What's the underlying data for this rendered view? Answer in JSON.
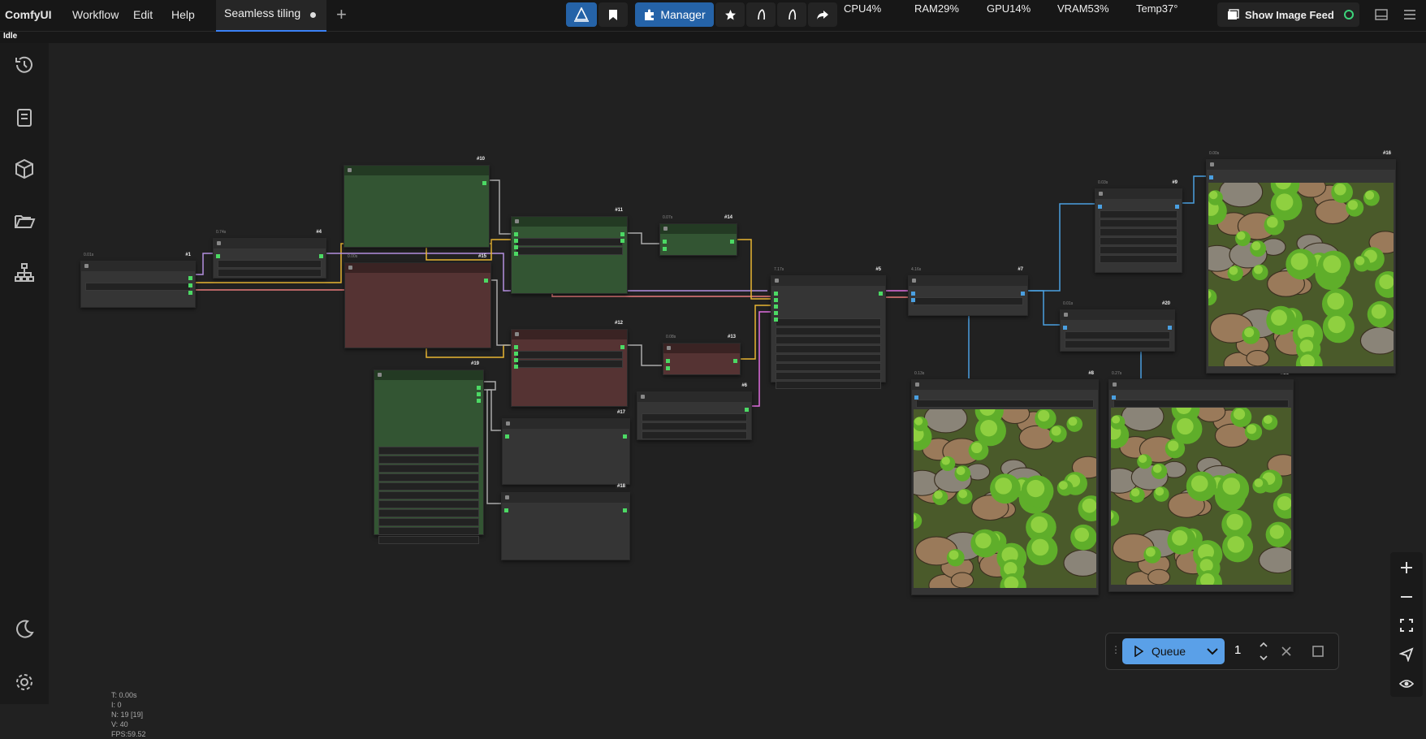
{
  "app": {
    "name": "ComfyUI"
  },
  "menu": {
    "workflow": "Workflow",
    "edit": "Edit",
    "help": "Help"
  },
  "tabs": [
    {
      "label": "Seamless tiling",
      "unsaved": true
    }
  ],
  "toolbar": {
    "manager_label": "Manager",
    "show_feed_label": "Show Image Feed"
  },
  "system_stats": {
    "cpu": "CPU4%",
    "ram": "RAM29%",
    "gpu": "GPU14%",
    "vram": "VRAM53%",
    "temp": "Temp37°"
  },
  "status": {
    "text": "Idle"
  },
  "sidebar": {
    "items": [
      {
        "icon": "history-icon"
      },
      {
        "icon": "book-icon"
      },
      {
        "icon": "cube-icon"
      },
      {
        "icon": "folder-icon"
      },
      {
        "icon": "workflow-tree-icon"
      }
    ],
    "bottom": [
      {
        "icon": "moon-icon"
      },
      {
        "icon": "gear-icon"
      }
    ]
  },
  "nodes": [
    {
      "id": "#1",
      "time": "0.01s",
      "color": "default"
    },
    {
      "id": "#4",
      "time": "0.74s",
      "color": "default"
    },
    {
      "id": "#10",
      "time": "",
      "color": "green"
    },
    {
      "id": "#15",
      "time": "0.00s",
      "color": "red"
    },
    {
      "id": "#11",
      "time": "",
      "color": "green"
    },
    {
      "id": "#14",
      "time": "0.07s",
      "color": "green"
    },
    {
      "id": "#12",
      "time": "",
      "color": "red"
    },
    {
      "id": "#13",
      "time": "0.08s",
      "color": "red"
    },
    {
      "id": "#19",
      "time": "",
      "color": "green"
    },
    {
      "id": "#6",
      "time": "",
      "color": "default"
    },
    {
      "id": "#17",
      "time": "",
      "color": "default"
    },
    {
      "id": "#18",
      "time": "",
      "color": "default"
    },
    {
      "id": "#5",
      "time": "7.17s",
      "color": "default"
    },
    {
      "id": "#7",
      "time": "4.16s",
      "color": "default"
    },
    {
      "id": "#9",
      "time": "0.03s",
      "color": "default"
    },
    {
      "id": "#20",
      "time": "0.01s",
      "color": "default"
    },
    {
      "id": "#8",
      "time": "0.13s",
      "color": "default"
    },
    {
      "id": "#21",
      "time": "0.27s",
      "color": "default"
    },
    {
      "id": "#16",
      "time": "0.00s",
      "color": "default"
    }
  ],
  "stats_overlay": {
    "t": "T: 0.00s",
    "i": "I: 0",
    "n": "N: 19 [19]",
    "v": "V: 40",
    "fps": "FPS:59.52"
  },
  "queue": {
    "label": "Queue",
    "count": "1"
  },
  "colors": {
    "accent": "#3b82f6",
    "node_green": "#335533",
    "node_red": "#553333",
    "wire_yellow": "#e8b533",
    "wire_pink": "#e87a7a",
    "wire_purple": "#b48fe0",
    "wire_blue": "#4a9fe0",
    "wire_magenta": "#e06ee0"
  }
}
